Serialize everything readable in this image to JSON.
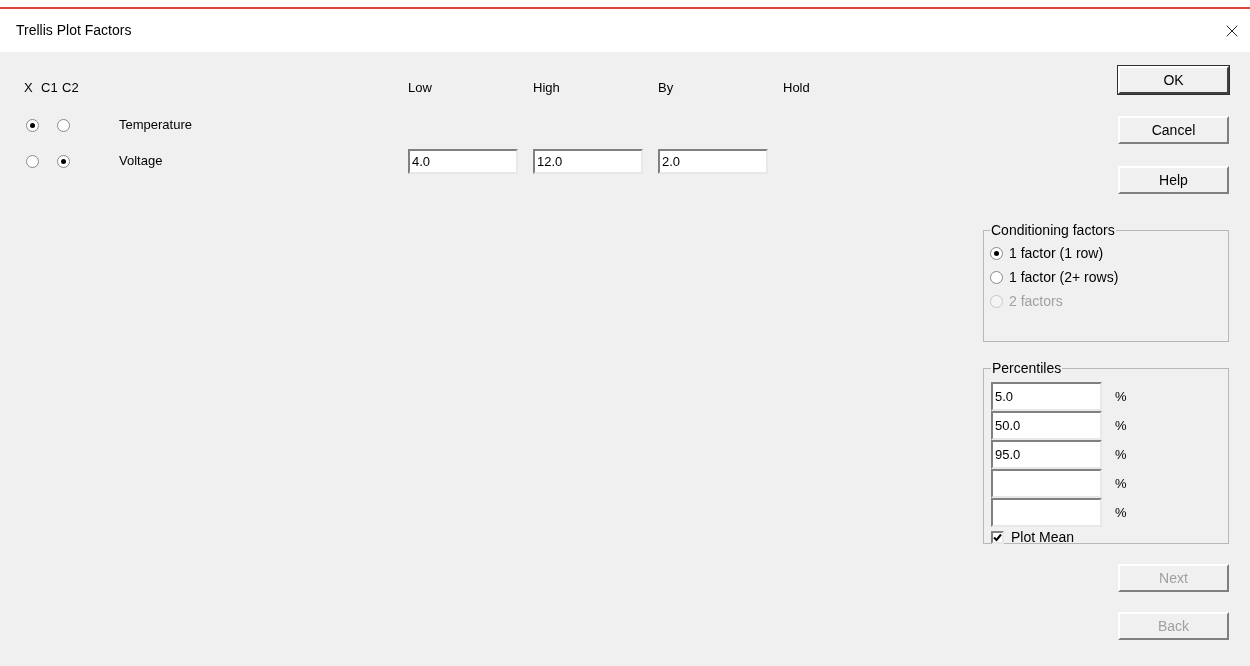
{
  "window": {
    "title": "Trellis Plot Factors"
  },
  "columns": [
    "X",
    "C1",
    "C2",
    "Low",
    "High",
    "By",
    "Hold"
  ],
  "factors": [
    {
      "name": "Temperature",
      "radios": [
        {
          "selected": true
        },
        {
          "selected": false
        }
      ]
    },
    {
      "name": "Voltage",
      "radios": [
        {
          "selected": false
        },
        {
          "selected": true
        }
      ],
      "fields": [
        "4.0",
        "12.0",
        "2.0"
      ]
    }
  ],
  "top_buttons": [
    {
      "label": "OK",
      "default": true,
      "disabled": false
    },
    {
      "label": "Cancel",
      "default": false,
      "disabled": false
    },
    {
      "label": "Help",
      "default": false,
      "disabled": false
    }
  ],
  "conditioning_factors": {
    "title": "Conditioning factors",
    "options": [
      {
        "label": "1 factor (1 row)",
        "selected": true,
        "disabled": false
      },
      {
        "label": "1 factor (2+ rows)",
        "selected": false,
        "disabled": false
      },
      {
        "label": "2 factors",
        "selected": false,
        "disabled": true
      }
    ]
  },
  "percentiles": {
    "title": "Percentiles",
    "fields": [
      {
        "value": "5.0",
        "unit": "%"
      },
      {
        "value": "50.0",
        "unit": "%"
      },
      {
        "value": "95.0",
        "unit": "%"
      },
      {
        "unit": "%"
      },
      {
        "unit": "%"
      }
    ],
    "plot_mean": {
      "label": "Plot Mean",
      "checked": true
    }
  },
  "bottom_buttons": [
    {
      "label": "Next",
      "default": false,
      "disabled": true
    },
    {
      "label": "Back",
      "default": false,
      "disabled": true
    }
  ]
}
